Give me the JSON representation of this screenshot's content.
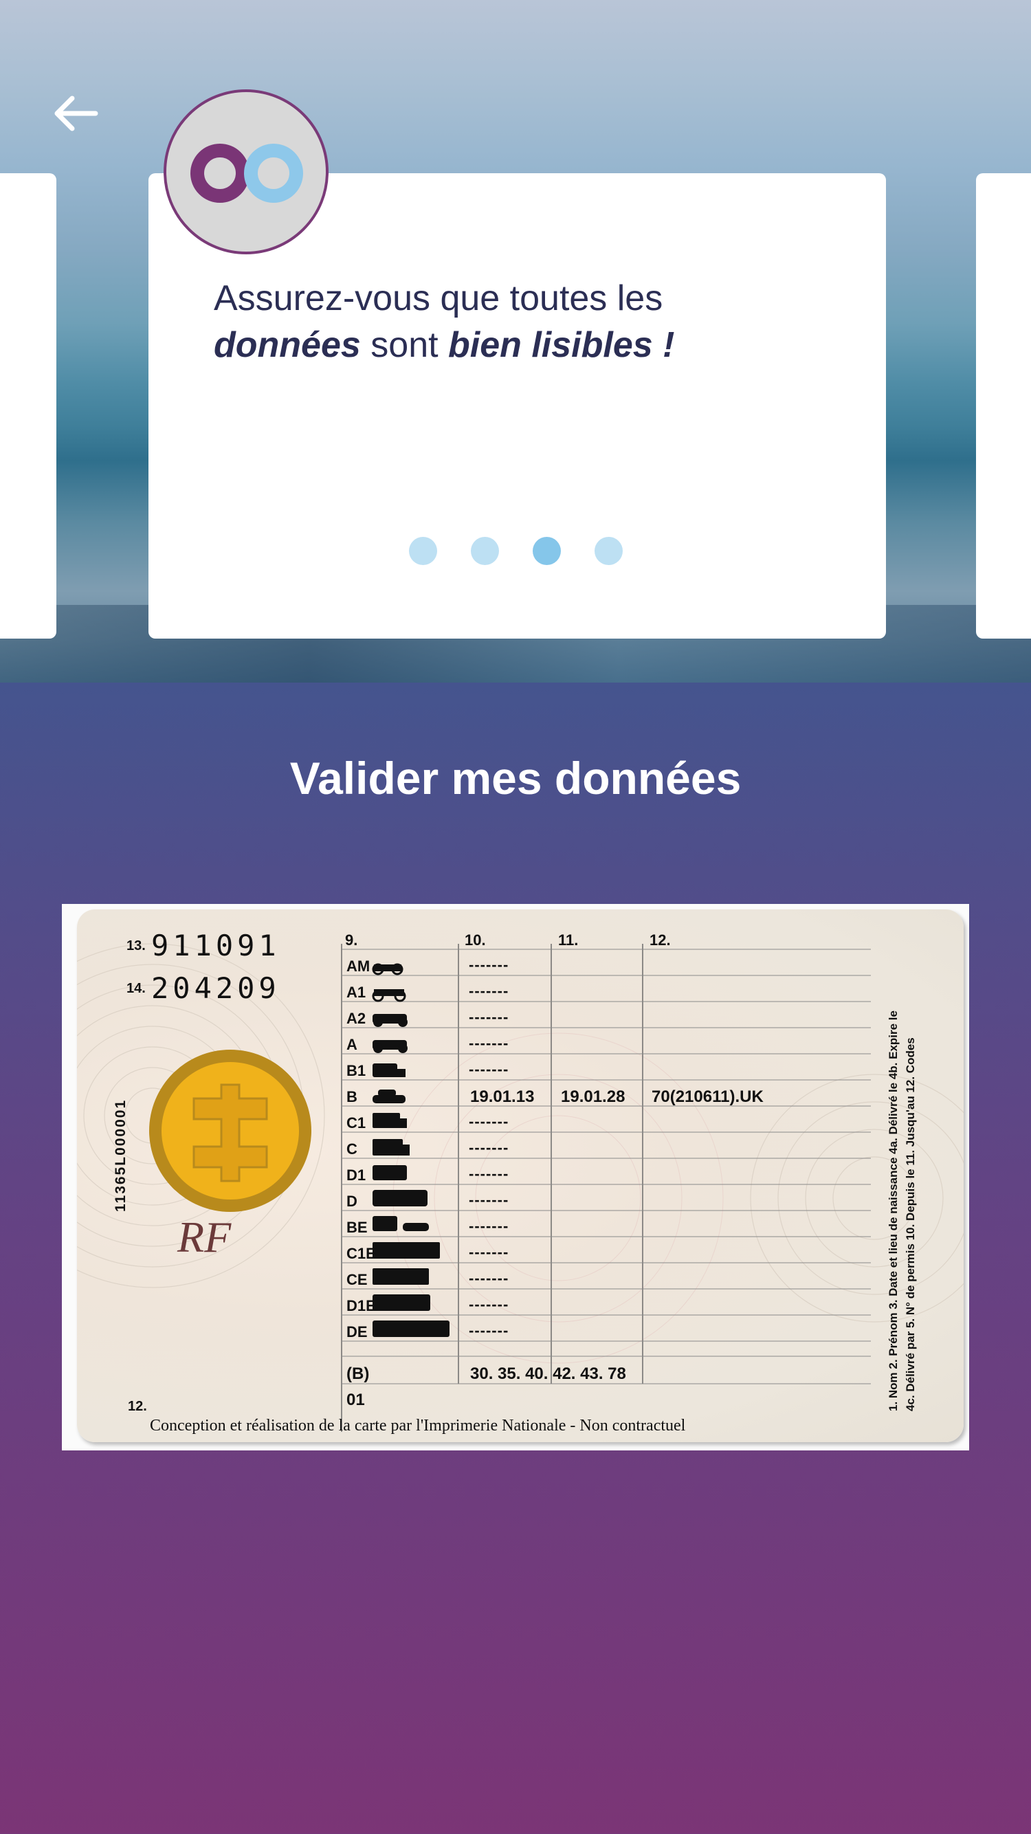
{
  "nav": {
    "back_icon": "arrow-left-icon"
  },
  "tip_card": {
    "logo_icon": "two-circles-logo-icon",
    "line1": "Assurez-vous que toutes les",
    "line2_bold1": "données",
    "line2_mid": " sont ",
    "line2_bold2": "bien lisibles !",
    "pagination": {
      "total": 4,
      "active_index": 3
    }
  },
  "section": {
    "title": "Valider mes données"
  },
  "license_image": {
    "field13_label": "13.",
    "field13_value": "911091",
    "field14_label": "14.",
    "field14_value": "204209",
    "field12_label": "12.",
    "serial_vertical": "11365L000001",
    "rf_mark": "RF",
    "col_headers": [
      "9.",
      "10.",
      "11.",
      "12."
    ],
    "categories": [
      "AM",
      "A1",
      "A2",
      "A",
      "B1",
      "B",
      "C1",
      "C",
      "D1",
      "D",
      "BE",
      "C1E",
      "CE",
      "D1E",
      "DE"
    ],
    "dashes": "-------",
    "row_b": {
      "col10": "19.01.13",
      "col11": "19.01.28",
      "col12": "70(210611).UK"
    },
    "row_extra_cat": "(B)",
    "row_extra_val": "30. 35. 40. 42. 43. 78",
    "row_01": "01",
    "footer": "Conception et réalisation de la carte par l'Imprimerie Nationale - Non contractuel",
    "legend_line1": "1. Nom 2. Prénom 3. Date et lieu de naissance 4a. Délivré le 4b. Expire le",
    "legend_line2": "4c. Délivré par 5. N° de permis 10. Depuis le 11. Jusqu'au 12. Codes"
  }
}
